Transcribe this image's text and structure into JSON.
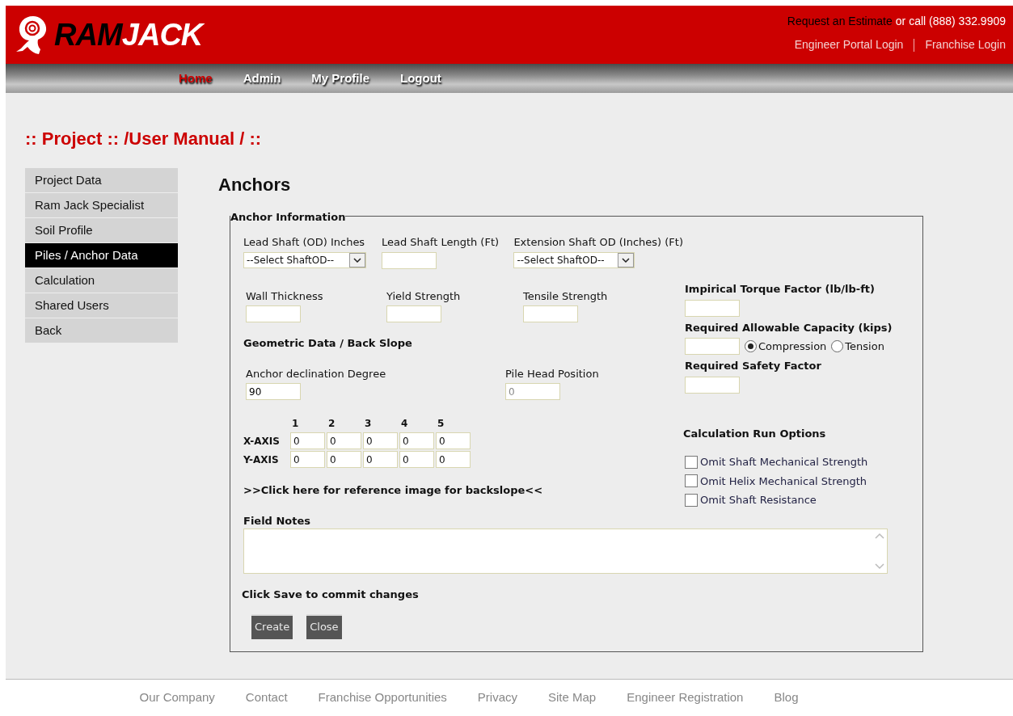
{
  "header": {
    "logo": {
      "part1": "RAM",
      "part2": "JACK"
    },
    "estimate_link": "Request an Estimate",
    "call_text": "or call (888) 332.9909",
    "links": [
      "Engineer Portal Login",
      "Franchise Login"
    ]
  },
  "nav": [
    {
      "label": "Home",
      "selected": true
    },
    {
      "label": "Admin",
      "selected": false
    },
    {
      "label": "My Profile",
      "selected": false
    },
    {
      "label": "Logout",
      "selected": false
    }
  ],
  "page_title": ":: Project :: /User Manual / ::",
  "sidebar": [
    {
      "label": "Project Data",
      "selected": false
    },
    {
      "label": "Ram Jack Specialist",
      "selected": false
    },
    {
      "label": "Soil Profile",
      "selected": false
    },
    {
      "label": "Piles / Anchor Data",
      "selected": true
    },
    {
      "label": "Calculation",
      "selected": false
    },
    {
      "label": "Shared Users",
      "selected": false
    },
    {
      "label": "Back",
      "selected": false
    }
  ],
  "section_title": "Anchors",
  "form": {
    "legend": "Anchor Information",
    "row1": [
      {
        "kind": "select",
        "label": "Lead Shaft (OD) Inches",
        "value": "--Select ShaftOD--"
      },
      {
        "kind": "input",
        "label": "Lead Shaft Length (Ft)"
      },
      {
        "kind": "select",
        "label": "Extension Shaft OD (Inches) (Ft)",
        "value": "--Select ShaftOD--"
      }
    ],
    "row2": [
      {
        "label": "Wall Thickness"
      },
      {
        "label": "Yield Strength"
      },
      {
        "label": "Tensile Strength"
      }
    ],
    "geometric_heading": "Geometric Data / Back Slope",
    "row3": [
      {
        "label": "Anchor declination Degree",
        "value": "90",
        "disabled": false
      },
      {
        "label": "Pile Head Position",
        "value": "0",
        "disabled": true
      }
    ],
    "axis_columns": [
      "1",
      "2",
      "3",
      "4",
      "5"
    ],
    "axes": [
      {
        "label": "X-AXIS",
        "values": [
          "0",
          "0",
          "0",
          "0",
          "0"
        ]
      },
      {
        "label": "Y-AXIS",
        "values": [
          "0",
          "0",
          "0",
          "0",
          "0"
        ]
      }
    ],
    "reference_link": ">>Click here for reference image for backslope<<",
    "right": [
      {
        "label": "Impirical Torque Factor (lb/lb-ft)"
      },
      {
        "label": "Required Allowable Capacity (kips)",
        "radios": [
          {
            "label": "Compression",
            "selected": true
          },
          {
            "label": "Tension",
            "selected": false
          }
        ]
      },
      {
        "label": "Required Safety Factor"
      }
    ],
    "run_options_heading": "Calculation Run Options",
    "run_options": [
      {
        "label": "Omit Shaft Mechanical Strength",
        "checked": false
      },
      {
        "label": "Omit Helix Mechanical Strength",
        "checked": false
      },
      {
        "label": "Omit Shaft Resistance",
        "checked": false
      }
    ],
    "field_notes_label": "Field Notes",
    "save_hint": "Click Save to commit changes",
    "buttons": [
      "Create",
      "Close"
    ]
  },
  "footer": [
    "Our Company",
    "Contact",
    "Franchise Opportunities",
    "Privacy",
    "Site Map",
    "Engineer Registration",
    "Blog"
  ]
}
